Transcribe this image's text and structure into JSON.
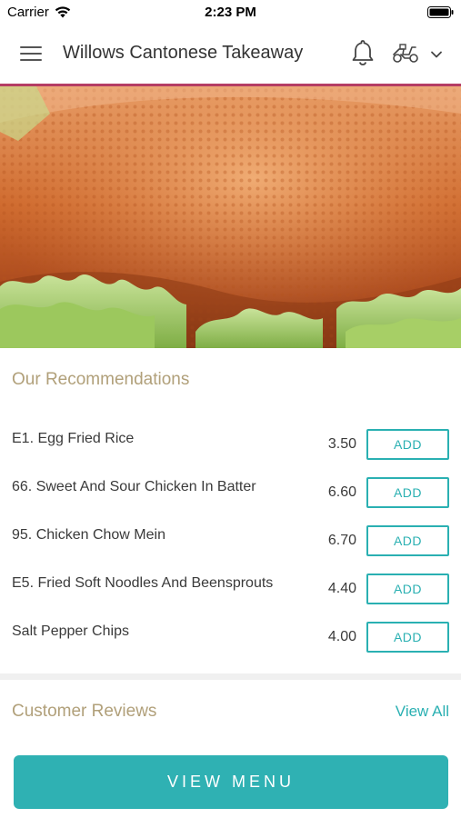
{
  "status_bar": {
    "carrier": "Carrier",
    "time": "2:23 PM"
  },
  "header": {
    "title": "Willows Cantonese Takeaway",
    "accent_color": "#b53d64"
  },
  "recommendations": {
    "title": "Our Recommendations",
    "items": [
      {
        "name": "E1. Egg Fried Rice",
        "price": "3.50",
        "button": "ADD"
      },
      {
        "name": "66. Sweet And Sour Chicken In Batter",
        "price": "6.60",
        "button": "ADD"
      },
      {
        "name": "95. Chicken Chow Mein",
        "price": "6.70",
        "button": "ADD"
      },
      {
        "name": "E5. Fried Soft Noodles And Beensprouts",
        "price": "4.40",
        "button": "ADD"
      },
      {
        "name": "Salt Pepper Chips",
        "price": "4.00",
        "button": "ADD"
      }
    ]
  },
  "reviews": {
    "title": "Customer Reviews",
    "view_all": "View All"
  },
  "footer": {
    "view_menu": "VIEW MENU"
  },
  "colors": {
    "teal": "#2ab0b2",
    "section_title": "#b1a07a"
  }
}
